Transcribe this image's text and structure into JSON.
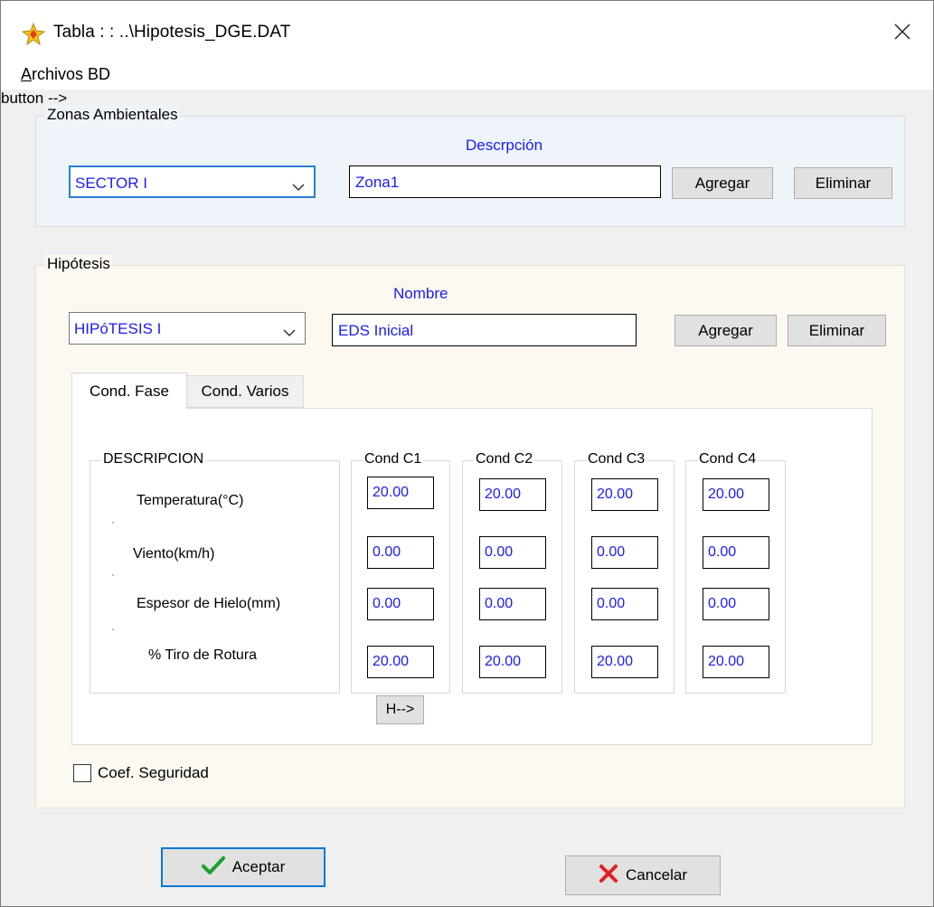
{
  "window": {
    "title": "Tabla : : ..\\Hipotesis_DGE.DAT",
    "close_glyph": "✕"
  },
  "menubar": {
    "items": [
      {
        "accel": "A",
        "rest": "rchivos BD"
      }
    ]
  },
  "zonas": {
    "legend": "Zonas Ambientales",
    "description_label": "Descrpción",
    "combo_value": "SECTOR I",
    "description_value": "Zona1",
    "add_label": "Agregar",
    "delete_label": "Eliminar"
  },
  "hipotesis": {
    "legend": "Hipótesis",
    "name_label": "Nombre",
    "combo_value": "HIPóTESIS I",
    "name_value": "EDS Inicial",
    "add_label": "Agregar",
    "delete_label": "Eliminar",
    "tabs": [
      {
        "label": "Cond. Fase",
        "active": true
      },
      {
        "label": "Cond. Varios",
        "active": false
      }
    ],
    "table": {
      "description_header": "DESCRIPCION",
      "rows": [
        "Temperatura(°C)",
        "Viento(km/h)",
        "Espesor de Hielo(mm)",
        "% Tiro de Rotura"
      ],
      "columns": [
        {
          "header": "Cond C1",
          "values": [
            "20.00",
            "0.00",
            "0.00",
            "20.00"
          ]
        },
        {
          "header": "Cond C2",
          "values": [
            "20.00",
            "0.00",
            "0.00",
            "20.00"
          ]
        },
        {
          "header": "Cond C3",
          "values": [
            "20.00",
            "0.00",
            "0.00",
            "20.00"
          ]
        },
        {
          "header": "Cond C4",
          "values": [
            "20.00",
            "0.00",
            "0.00",
            "20.00"
          ]
        }
      ],
      "h_button_label": "H-->"
    },
    "coef_checkbox": {
      "label": "Coef. Seguridad",
      "checked": false
    }
  },
  "buttons": {
    "accept_label": "Aceptar",
    "cancel_label": "Cancelar"
  },
  "colors": {
    "value_text": "#1a1aff",
    "accept_icon": "#1e9e2e",
    "cancel_icon": "#e02020",
    "focus_border": "#2a7fd4"
  },
  "icons": {
    "app": "app-star-icon",
    "close": "close-icon",
    "dropdown": "chevron-down-icon",
    "accept": "checkmark-icon",
    "cancel": "x-icon"
  }
}
